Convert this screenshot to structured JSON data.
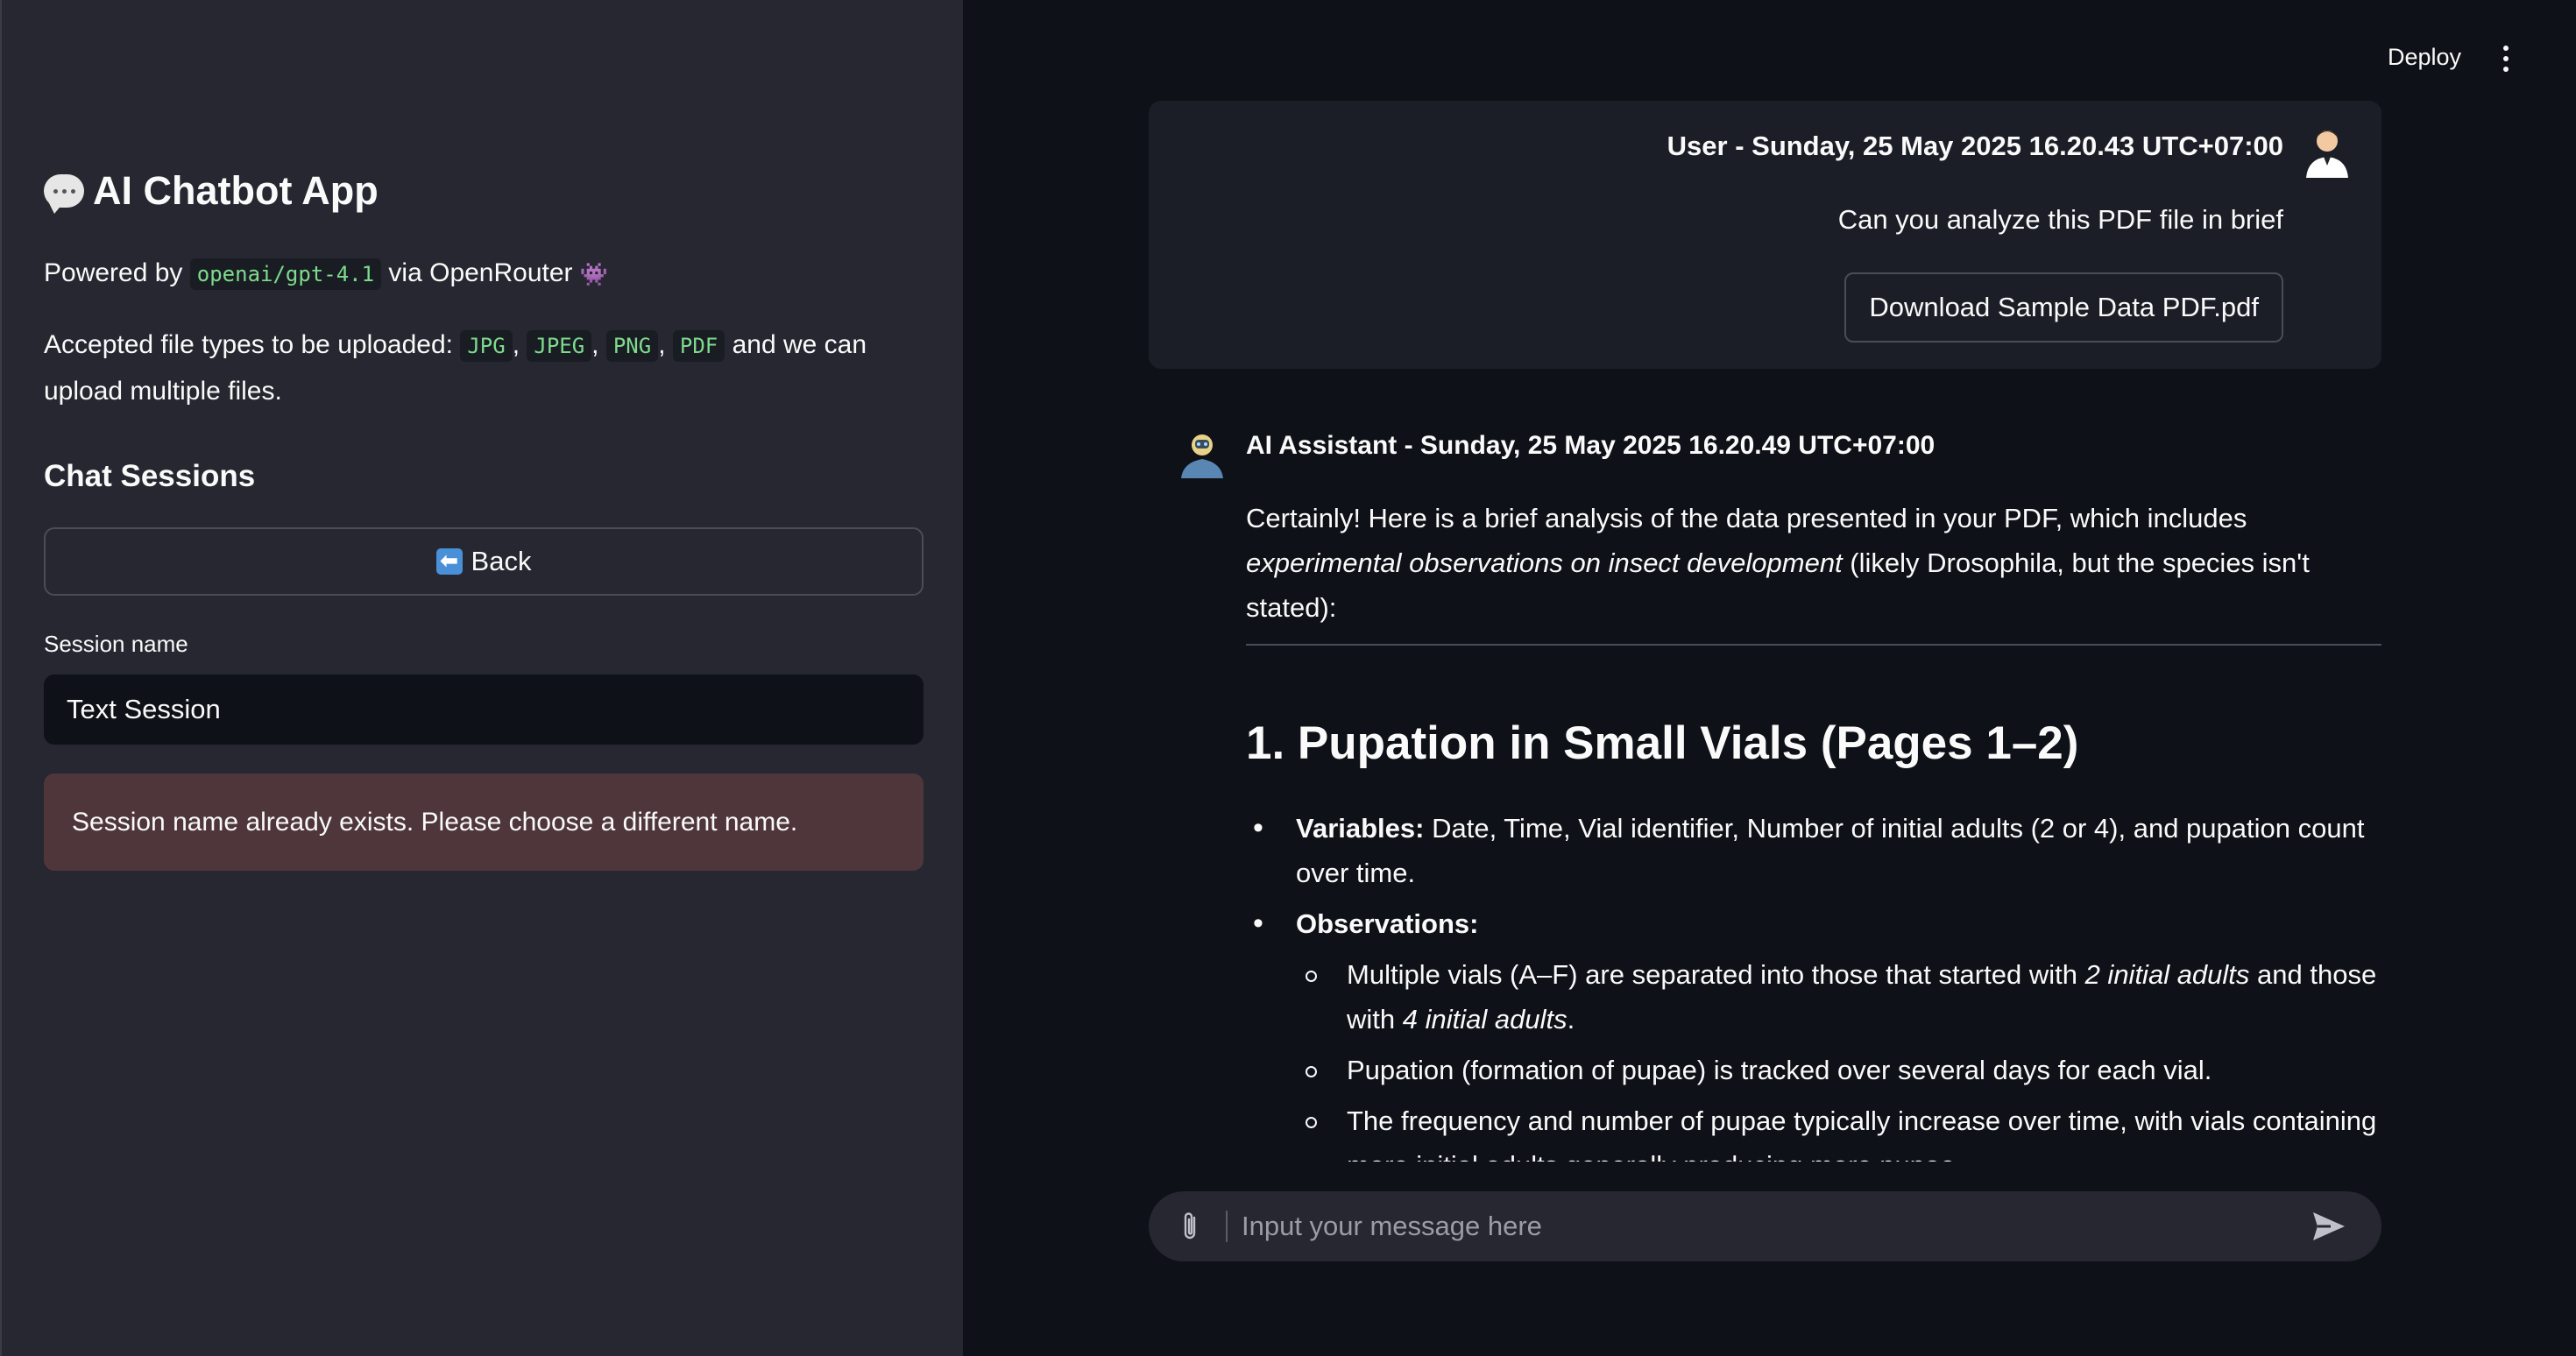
{
  "sidebar": {
    "title": "AI Chatbot App",
    "powered_prefix": "Powered by",
    "model": "openai/gpt-4.1",
    "powered_suffix": "via OpenRouter",
    "accepted_prefix": "Accepted file types to be uploaded:",
    "file_types": [
      "JPG",
      "JPEG",
      "PNG",
      "PDF"
    ],
    "accepted_suffix": "and we can",
    "accepted_line2": "upload multiple files.",
    "chat_sessions_heading": "Chat Sessions",
    "back_label": "Back",
    "session_name_label": "Session name",
    "session_name_value": "Text Session",
    "error_message": "Session name already exists. Please choose a different name."
  },
  "header": {
    "deploy_label": "Deploy",
    "menu_icon": "vertical-ellipsis-icon"
  },
  "chat": {
    "user_message": {
      "header": "User - Sunday, 25 May 2025 16.20.43 UTC+07:00",
      "text": "Can you analyze this PDF file in brief",
      "attachment_label": "Download Sample Data PDF.pdf"
    },
    "assistant_message": {
      "header": "AI Assistant - Sunday, 25 May 2025 16.20.49 UTC+07:00",
      "intro_a": "Certainly! Here is a brief analysis of the data presented in your PDF, which includes ",
      "intro_em": "experimental observations on insect development",
      "intro_b": " (likely Drosophila, but the species isn't stated):",
      "section_heading": "1. Pupation in Small Vials (Pages 1–2)",
      "variables_label": "Variables:",
      "variables_text": " Date, Time, Vial identifier, Number of initial adults (2 or 4), and pupation count over time.",
      "observations_label": "Observations:",
      "obs1_a": "Multiple vials (A–F) are separated into those that started with ",
      "obs1_em1": "2 initial adults",
      "obs1_b": " and those with ",
      "obs1_em2": "4 initial adults",
      "obs1_c": ".",
      "obs2": "Pupation (formation of pupae) is tracked over several days for each vial.",
      "obs3": "The frequency and number of pupae typically increase over time, with vials containing more initial adults generally producing more pupae."
    },
    "input_placeholder": "Input your message here"
  },
  "icons": {
    "title": "speech-bubble-icon",
    "powered": "alien-icon",
    "back": "back-arrow-icon",
    "user_avatar": "user-avatar-icon",
    "assistant_avatar": "assistant-avatar-icon",
    "attach": "paperclip-icon",
    "send": "send-icon"
  },
  "colors": {
    "sidebar_bg": "#262730",
    "main_bg": "#0e1117",
    "code_text": "#7ddc8c",
    "error_bg": "#4f363b"
  }
}
